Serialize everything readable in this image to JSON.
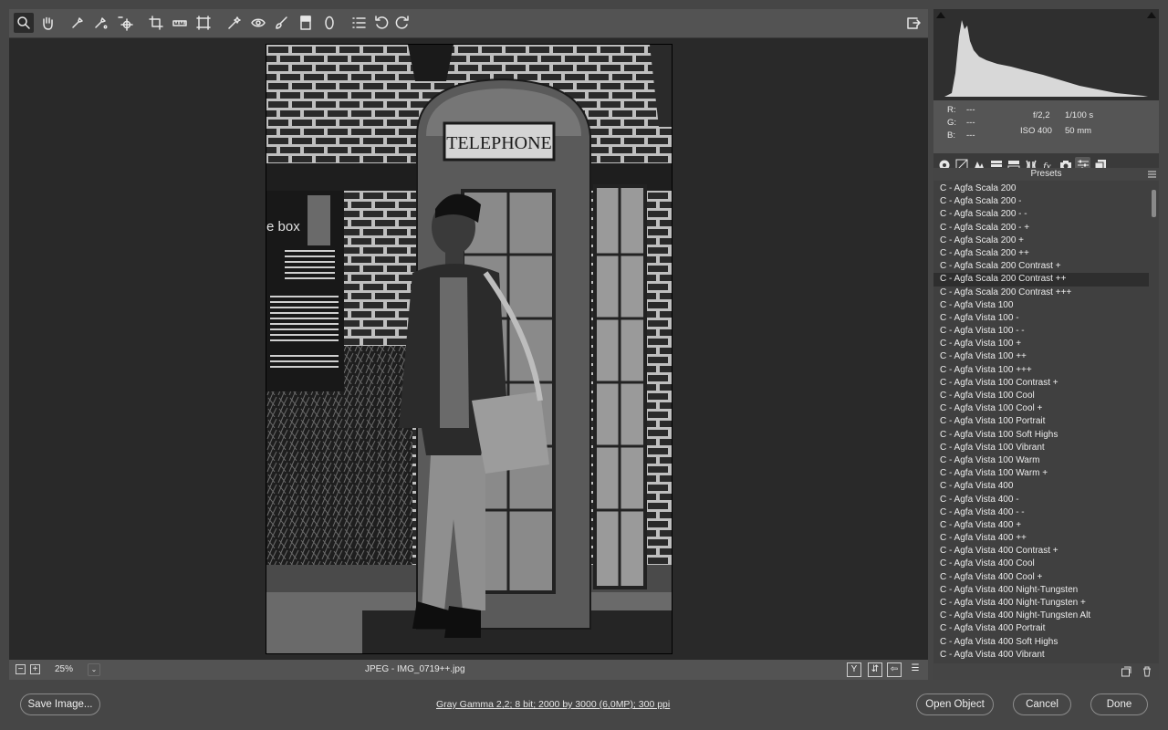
{
  "toolbar": {
    "tools": [
      "zoom-tool",
      "hand-tool",
      "white-balance-tool",
      "color-sampler-tool",
      "targeted-adjustment-tool",
      "crop-tool",
      "straighten-tool",
      "transform-tool",
      "spot-removal-tool",
      "red-eye-tool",
      "adjustment-brush-tool",
      "graduated-filter-tool",
      "radial-filter-tool",
      "open-preferences",
      "rotate-left",
      "rotate-right"
    ],
    "fullscreen": "fullscreen-toggle"
  },
  "photo": {
    "sign_text": "TELEPHONE",
    "board_heading": "e box"
  },
  "status": {
    "zoom": "25%",
    "file": "JPEG  -  IMG_0719++.jpg"
  },
  "info": {
    "r_label": "R:",
    "r_value": "---",
    "g_label": "G:",
    "g_value": "---",
    "b_label": "B:",
    "b_value": "---",
    "aperture": "f/2,2",
    "shutter": "1/100 s",
    "iso": "ISO 400",
    "focal": "50 mm"
  },
  "presets": {
    "title": "Presets",
    "selected_index": 7,
    "items": [
      "C - Agfa Scala 200",
      "C - Agfa Scala 200 -",
      "C - Agfa Scala 200 - -",
      "C - Agfa Scala 200 - +",
      "C - Agfa Scala 200 +",
      "C - Agfa Scala 200 ++",
      "C - Agfa Scala 200 Contrast +",
      "C - Agfa Scala 200 Contrast ++",
      "C - Agfa Scala 200 Contrast +++",
      "C - Agfa Vista 100",
      "C - Agfa Vista 100 -",
      "C - Agfa Vista 100 - -",
      "C - Agfa Vista 100 +",
      "C - Agfa Vista 100 ++",
      "C - Agfa Vista 100 +++",
      "C - Agfa Vista 100 Contrast +",
      "C - Agfa Vista 100 Cool",
      "C - Agfa Vista 100 Cool +",
      "C - Agfa Vista 100 Portrait",
      "C - Agfa Vista 100 Soft Highs",
      "C - Agfa Vista 100 Vibrant",
      "C - Agfa Vista 100 Warm",
      "C - Agfa Vista 100 Warm +",
      "C - Agfa Vista 400",
      "C - Agfa Vista 400 -",
      "C - Agfa Vista 400 - -",
      "C - Agfa Vista 400 +",
      "C - Agfa Vista 400 ++",
      "C - Agfa Vista 400 Contrast +",
      "C - Agfa Vista 400 Cool",
      "C - Agfa Vista 400 Cool +",
      "C - Agfa Vista 400 Night-Tungsten",
      "C - Agfa Vista 400 Night-Tungsten +",
      "C - Agfa Vista 400 Night-Tungsten Alt",
      "C - Agfa Vista 400 Portrait",
      "C - Agfa Vista 400 Soft Highs",
      "C - Agfa Vista 400 Vibrant"
    ]
  },
  "footer": {
    "save": "Save Image...",
    "image_info": "Gray Gamma 2,2; 8 bit; 2000 by 3000 (6,0MP); 300 ppi",
    "open": "Open Object",
    "cancel": "Cancel",
    "done": "Done"
  },
  "colors": {
    "background": "#464646",
    "canvas": "#292929",
    "selected_preset": "#2e2e2e"
  }
}
